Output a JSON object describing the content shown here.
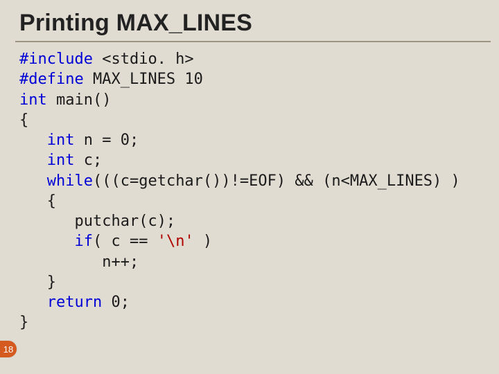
{
  "slide": {
    "title": "Printing MAX_LINES",
    "page_number": "18",
    "code_lines": [
      {
        "indent": 0,
        "segs": [
          [
            "dir",
            "#include"
          ],
          [
            "",
            " <stdio. h>"
          ]
        ]
      },
      {
        "indent": 0,
        "segs": [
          [
            "dir",
            "#define"
          ],
          [
            "",
            " MAX_LINES 10"
          ]
        ]
      },
      {
        "indent": 0,
        "segs": [
          [
            "kw",
            "int"
          ],
          [
            "",
            " main()"
          ]
        ]
      },
      {
        "indent": 0,
        "segs": [
          [
            "",
            "{"
          ]
        ]
      },
      {
        "indent": 1,
        "segs": [
          [
            "kw",
            "int"
          ],
          [
            "",
            " n = 0;"
          ]
        ]
      },
      {
        "indent": 1,
        "segs": [
          [
            "kw",
            "int"
          ],
          [
            "",
            " c;"
          ]
        ]
      },
      {
        "indent": 1,
        "segs": [
          [
            "kw",
            "while"
          ],
          [
            "",
            "(((c=getchar())!=EOF) && (n<MAX_LINES) )"
          ]
        ]
      },
      {
        "indent": 1,
        "segs": [
          [
            "",
            "{"
          ]
        ]
      },
      {
        "indent": 2,
        "segs": [
          [
            "",
            "putchar(c);"
          ]
        ]
      },
      {
        "indent": 2,
        "segs": [
          [
            "kw",
            "if"
          ],
          [
            "",
            "( c == "
          ],
          [
            "str",
            "'\\n'"
          ],
          [
            "",
            " )"
          ]
        ]
      },
      {
        "indent": 3,
        "segs": [
          [
            "",
            "n++;"
          ]
        ]
      },
      {
        "indent": 1,
        "segs": [
          [
            "",
            "}"
          ]
        ]
      },
      {
        "indent": 1,
        "segs": [
          [
            "kw",
            "return"
          ],
          [
            "",
            " 0;"
          ]
        ]
      },
      {
        "indent": 0,
        "segs": [
          [
            "",
            "}"
          ]
        ]
      }
    ]
  }
}
